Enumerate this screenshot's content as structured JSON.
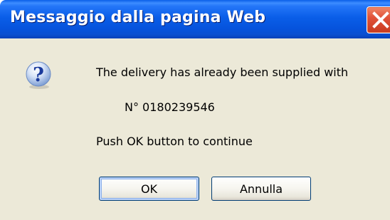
{
  "dialog": {
    "title": "Messaggio dalla pagina Web",
    "message_line1": "The delivery has already been supplied with",
    "message_line2": "N° 0180239546",
    "message_line3": "Push OK button to continue",
    "icon": "question-icon"
  },
  "buttons": {
    "ok_label": "OK",
    "cancel_label": "Annulla"
  },
  "titlebar": {
    "close_icon": "close-icon"
  },
  "colors": {
    "titlebar": "#0a5ee8",
    "body": "#ece9d8",
    "close_button": "#e1533a",
    "button_border": "#003c74"
  }
}
